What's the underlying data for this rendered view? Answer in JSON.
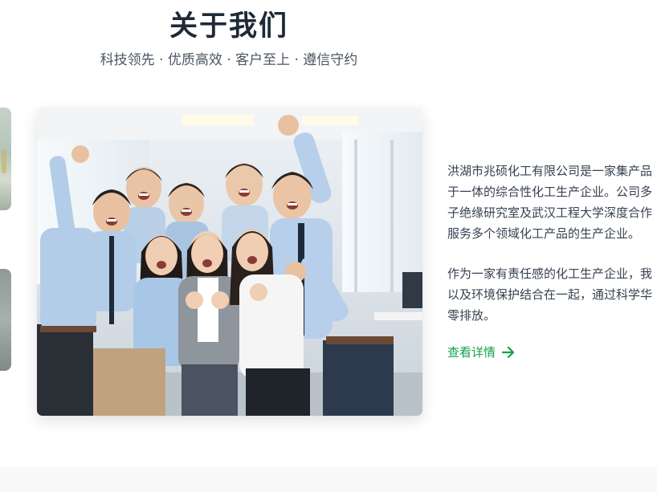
{
  "about": {
    "title": "关于我们",
    "subtitle": "科技领先 · 优质高效 · 客户至上 · 遵信守约",
    "paragraph_lines": [
      "洪湖市兆硕化工有限公司是一家集产品",
      "于一体的综合性化工生产企业。公司多",
      "子绝缘研究室及武汉工程大学深度合作",
      "服务多个领域化工产品的生产企业。"
    ],
    "paragraph2_lines": [
      "作为一家有责任感的化工生产企业，我",
      "以及环境保护结合在一起，通过科学华",
      "零排放。"
    ],
    "more_label": "查看详情"
  },
  "colors": {
    "accent": "#15a04a",
    "title": "#1f2a37",
    "body": "#374151"
  },
  "icons": {
    "more_arrow": "arrow-right-icon"
  }
}
